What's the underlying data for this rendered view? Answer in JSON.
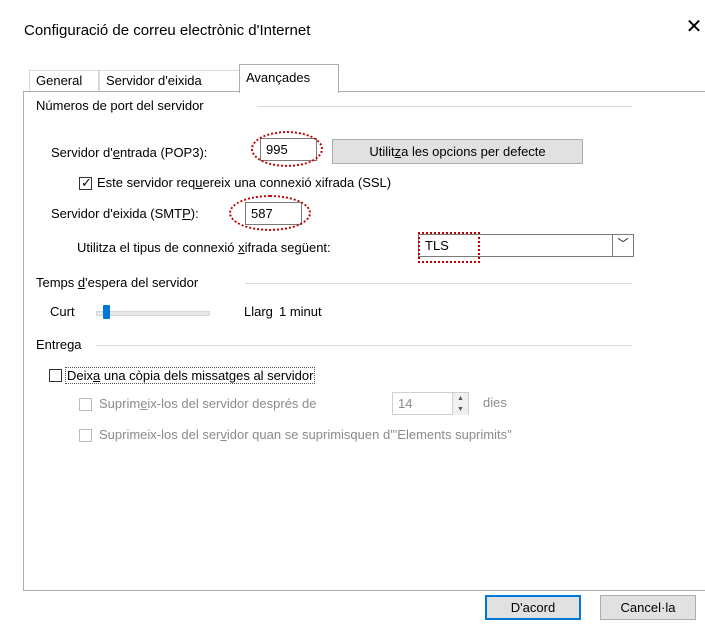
{
  "window": {
    "title": "Configuració de correu electrònic d'Internet"
  },
  "icons": {
    "close": "close-icon",
    "check": "check-icon",
    "chevron": "chevron-down-icon",
    "spin_up": "spin-up-icon",
    "spin_down": "spin-down-icon"
  },
  "tabs": [
    {
      "label": "General",
      "active": false
    },
    {
      "label": "Servidor d'eixida",
      "active": false
    },
    {
      "label": "Avançades",
      "active": true
    }
  ],
  "ports": {
    "group_label": "Números de port del servidor",
    "incoming_label_pre": "Servidor d'",
    "incoming_label_u": "e",
    "incoming_label_post": "ntrada (POP3):",
    "incoming_value": "995",
    "defaults_button_pre": "Utilit",
    "defaults_button_u": "z",
    "defaults_button_post": "a les opcions per defecte",
    "ssl_checked": true,
    "ssl_label_pre": "Este servidor req",
    "ssl_label_u": "u",
    "ssl_label_post": "ereix una connexió xifrada (SSL)",
    "outgoing_label_pre": "Servidor d'eixida (SMT",
    "outgoing_label_u": "P",
    "outgoing_label_post": "):",
    "outgoing_value": "587",
    "encryption_label_pre": "Utilitza el tipus de connexió ",
    "encryption_label_u": "x",
    "encryption_label_post": "ifrada següent:",
    "encryption_value": "TLS"
  },
  "timeout": {
    "group_label_pre": "Temps ",
    "group_label_u": "d",
    "group_label_post": "'espera del servidor",
    "short_label": "Curt",
    "long_label": "Llarg",
    "value_text": "1 minut",
    "slider_fraction": 0.07
  },
  "delivery": {
    "group_label": "Entrega",
    "leave_copy_checked": false,
    "leave_copy_pre": "Deix",
    "leave_copy_u": "a",
    "leave_copy_post": " una còpia dels missatges al servidor",
    "remove_after_checked": false,
    "remove_after_pre": "Suprim",
    "remove_after_u": "e",
    "remove_after_post": "ix-los del servidor després de",
    "remove_after_days": "14",
    "days_label": "dies",
    "remove_deleted_checked": false,
    "remove_deleted_pre": "Suprimeix-los del ser",
    "remove_deleted_u": "v",
    "remove_deleted_post": "idor quan se suprimisquen d'\"Elements suprimits\""
  },
  "buttons": {
    "ok": "D'acord",
    "cancel": "Cancel·la"
  }
}
